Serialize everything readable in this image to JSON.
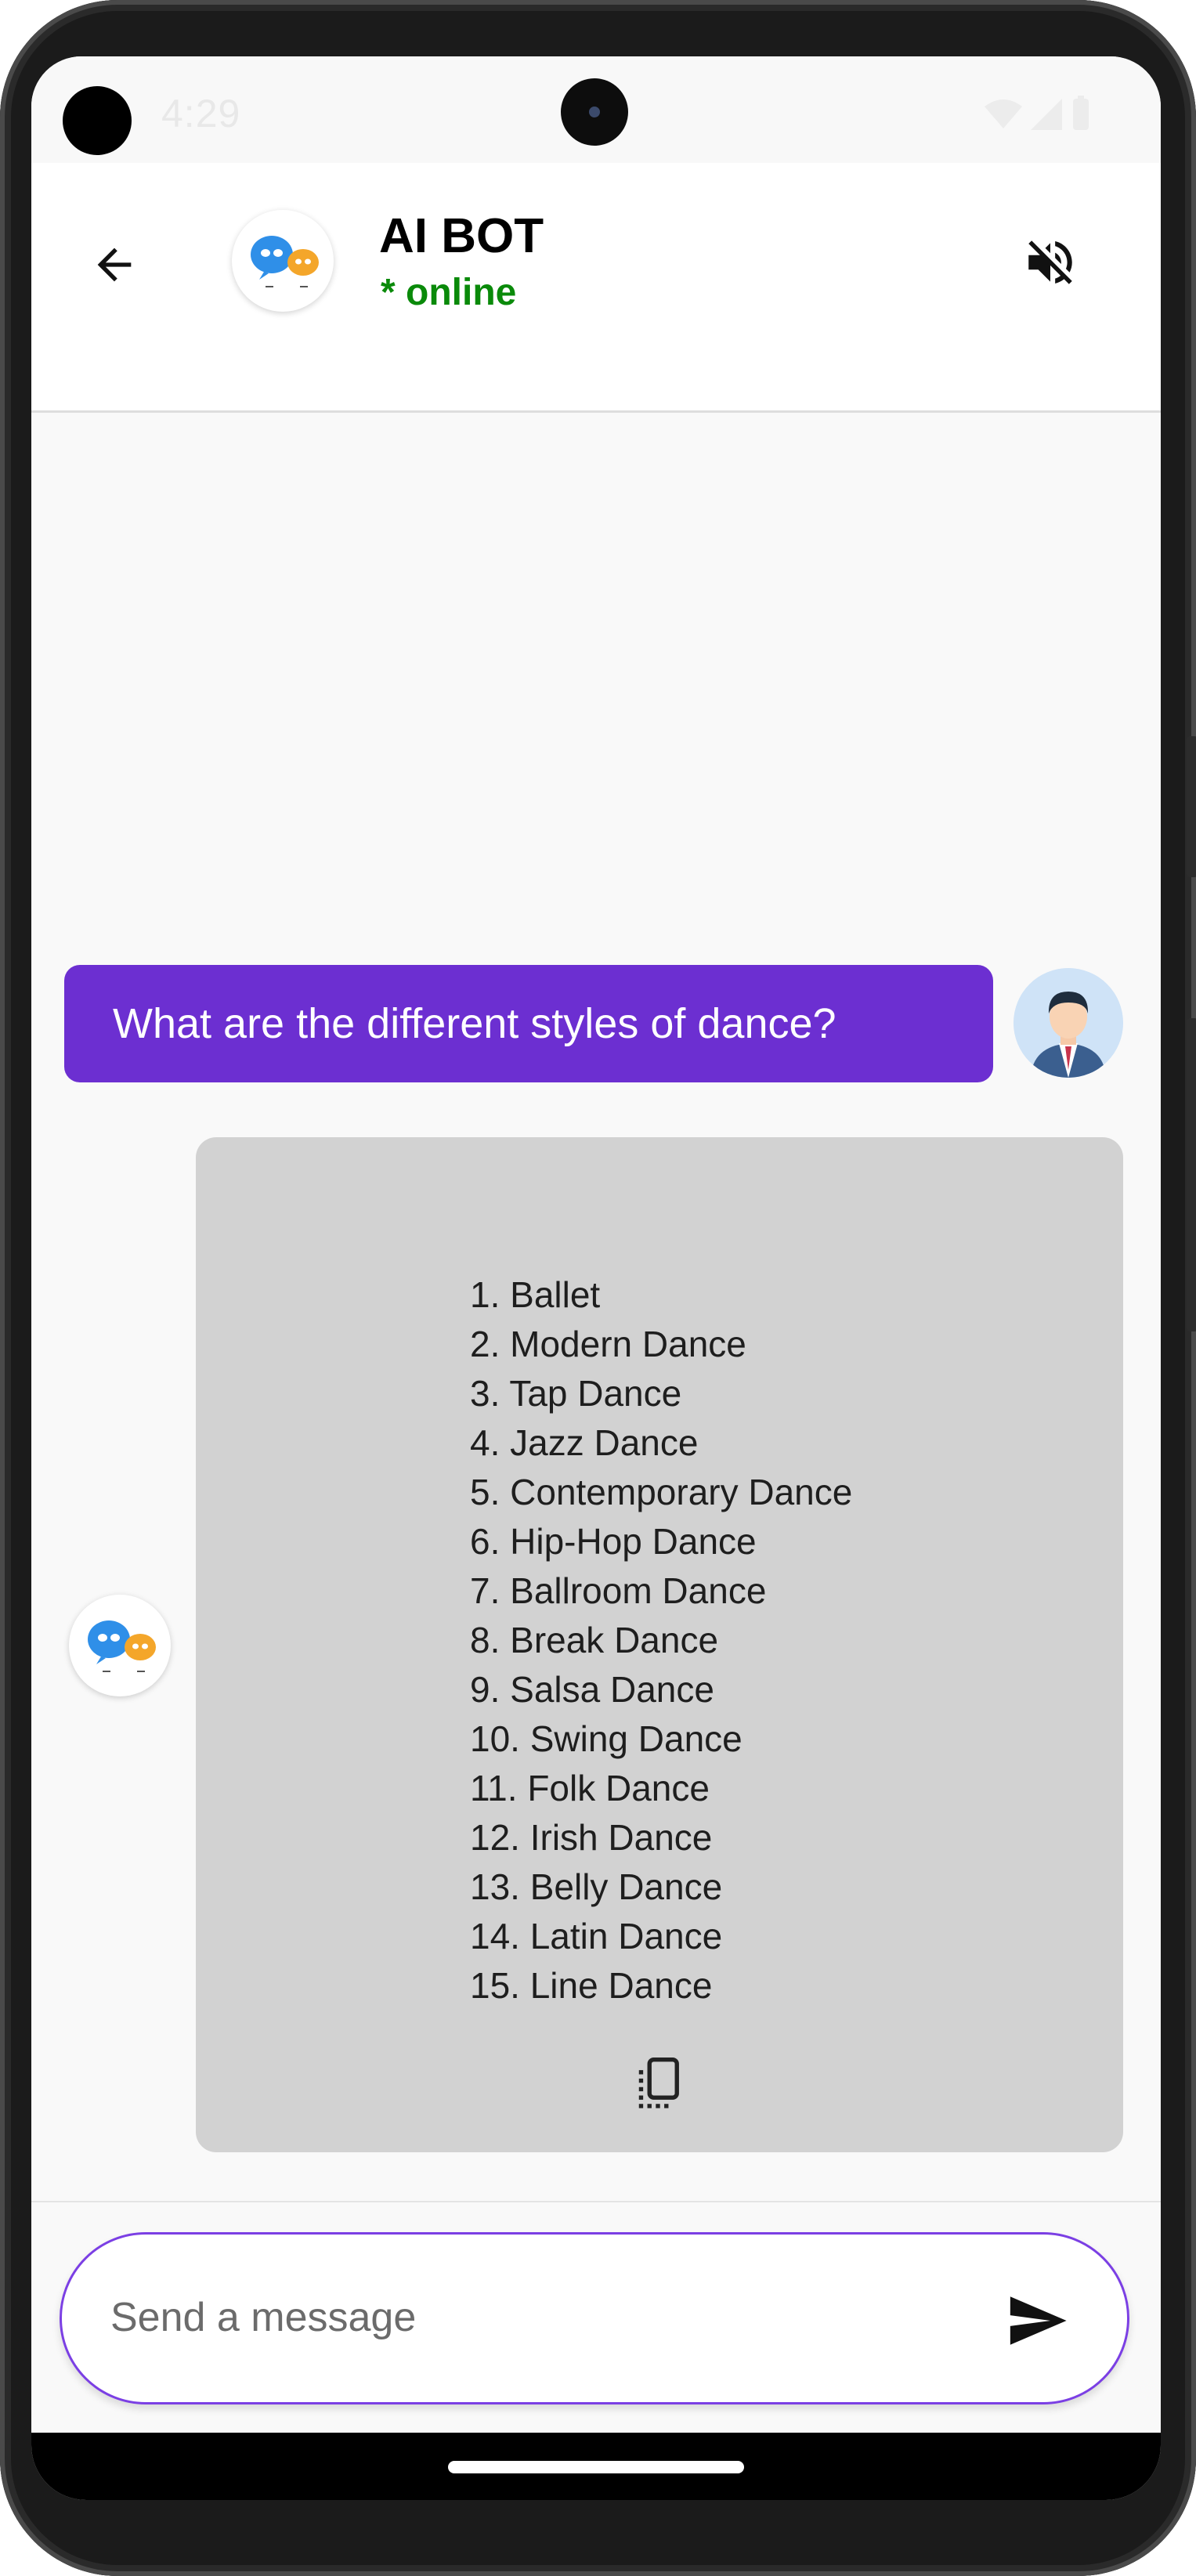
{
  "status_bar": {
    "time": "4:29",
    "icons": [
      "settings-icon",
      "wifi-icon",
      "signal-icon",
      "battery-icon"
    ]
  },
  "header": {
    "title": "AI BOT",
    "status": "* online",
    "icons": [
      "back-arrow-icon",
      "bot-avatar-icon",
      "volume-off-icon"
    ]
  },
  "chat": {
    "user_message": "What are the different styles of dance?",
    "bot_items": [
      "1. Ballet",
      "2. Modern Dance",
      "3. Tap Dance",
      "4. Jazz Dance",
      "5. Contemporary Dance",
      "6. Hip-Hop Dance",
      "7. Ballroom Dance",
      "8. Break Dance",
      "9. Salsa Dance",
      "10. Swing Dance",
      "11. Folk Dance",
      "12. Irish Dance",
      "13. Belly Dance",
      "14. Latin Dance",
      "15. Line Dance"
    ],
    "copy_icon": "copy-icon"
  },
  "input": {
    "placeholder": "Send a message",
    "value": "",
    "send_icon": "send-icon"
  },
  "colors": {
    "accent": "#6c2fd1",
    "online": "#0a8a0a",
    "bot_bubble": "#d2d2d2"
  }
}
